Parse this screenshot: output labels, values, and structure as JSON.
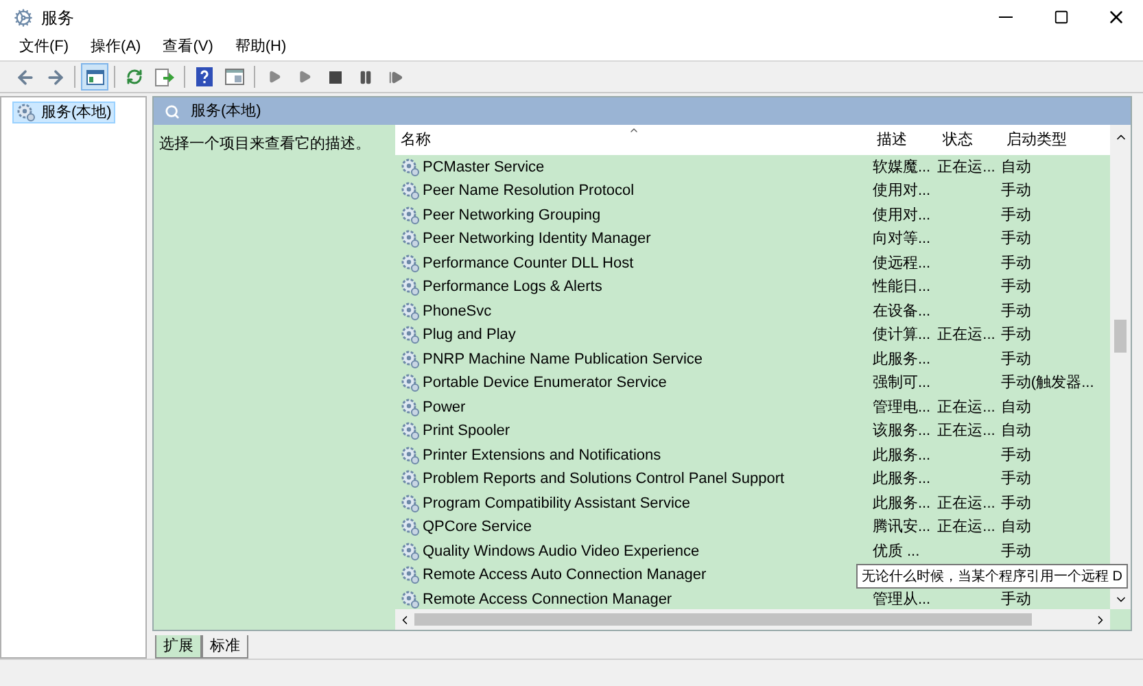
{
  "window": {
    "title": "服务"
  },
  "menu": [
    "文件(F)",
    "操作(A)",
    "查看(V)",
    "帮助(H)"
  ],
  "tree": [
    {
      "label": "服务(本地)",
      "selected": true
    }
  ],
  "panel": {
    "title": "服务(本地)",
    "description": "选择一个项目来查看它的描述。"
  },
  "table": {
    "columns": [
      "名称",
      "描述",
      "状态",
      "启动类型"
    ],
    "rows": [
      {
        "name": "PCMaster Service",
        "description": "软媒魔...",
        "status": "正在运...",
        "startup": "自动"
      },
      {
        "name": "Peer Name Resolution Protocol",
        "description": "使用对...",
        "startup": "手动"
      },
      {
        "name": "Peer Networking Grouping",
        "description": "使用对...",
        "startup": "手动"
      },
      {
        "name": "Peer Networking Identity Manager",
        "description": "向对等...",
        "startup": "手动"
      },
      {
        "name": "Performance Counter DLL Host",
        "description": "使远程...",
        "startup": "手动"
      },
      {
        "name": "Performance Logs & Alerts",
        "description": "性能日...",
        "startup": "手动"
      },
      {
        "name": "PhoneSvc",
        "description": "在设备...",
        "startup": "手动"
      },
      {
        "name": "Plug and Play",
        "description": "使计算...",
        "status": "正在运...",
        "startup": "手动"
      },
      {
        "name": "PNRP Machine Name Publication Service",
        "description": "此服务...",
        "startup": "手动"
      },
      {
        "name": "Portable Device Enumerator Service",
        "description": "强制可...",
        "startup": "手动(触发器..."
      },
      {
        "name": "Power",
        "description": "管理电...",
        "status": "正在运...",
        "startup": "自动"
      },
      {
        "name": "Print Spooler",
        "description": "该服务...",
        "status": "正在运...",
        "startup": "自动"
      },
      {
        "name": "Printer Extensions and Notifications",
        "description": "此服务...",
        "startup": "手动"
      },
      {
        "name": "Problem Reports and Solutions Control Panel Support",
        "description": "此服务...",
        "startup": "手动"
      },
      {
        "name": "Program Compatibility Assistant Service",
        "description": "此服务...",
        "status": "正在运...",
        "startup": "手动"
      },
      {
        "name": "QPCore Service",
        "description": "腾讯安...",
        "status": "正在运...",
        "startup": "自动"
      },
      {
        "name": "Quality Windows Audio Video Experience",
        "description": "优质 ...",
        "startup": "手动"
      },
      {
        "name": "Remote Access Auto Connection Manager"
      },
      {
        "name": "Remote Access Connection Manager",
        "description": "管理从...",
        "startup": "手动"
      }
    ]
  },
  "tooltip": "无论什么时候，当某个程序引用一个远程 D",
  "tabs": [
    {
      "label": "扩展",
      "selected": true
    },
    {
      "label": "标准",
      "selected": false
    }
  ]
}
